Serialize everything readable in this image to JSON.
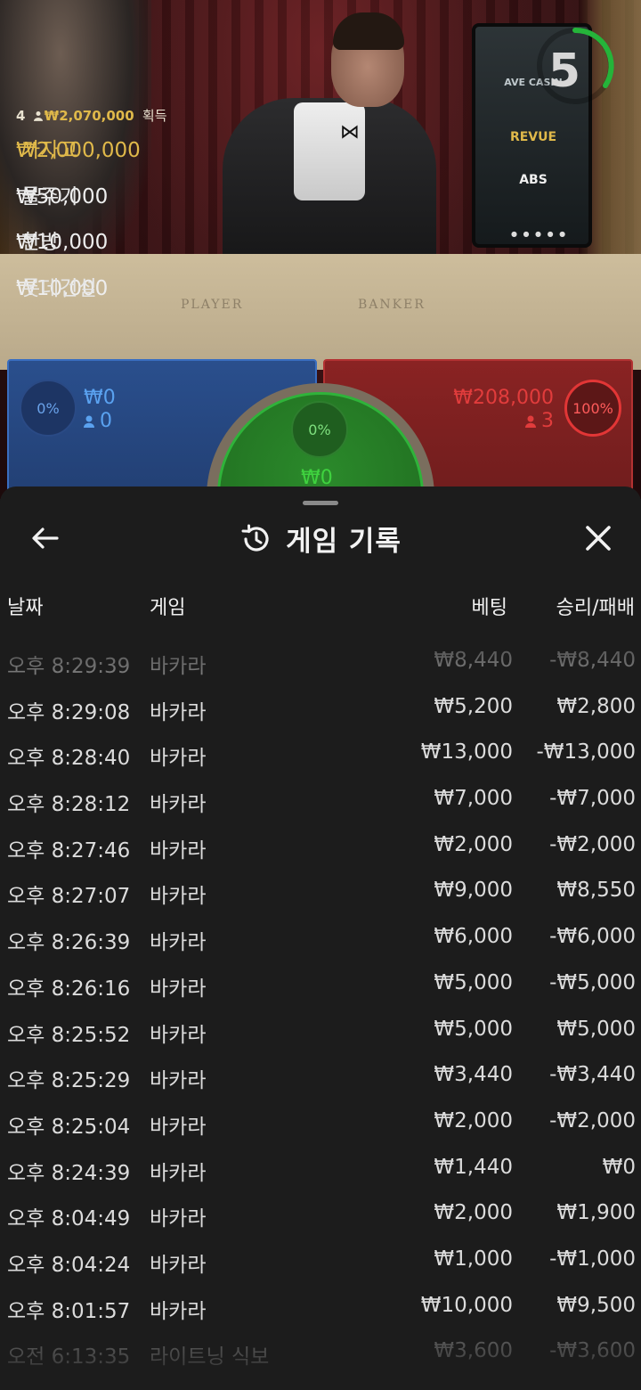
{
  "video": {
    "table_player_word": "PLAYER",
    "table_banker_word": "BANKER",
    "countdown": "5",
    "monitor_logos": [
      "AVE CASIN",
      "REVUE",
      "ABS"
    ]
  },
  "winners": {
    "count": "4",
    "total": "₩2,070,000",
    "total_suffix": "획득",
    "list": [
      {
        "amount": "₩2,000,000",
        "name": "가자고"
      },
      {
        "amount": "₩50,000",
        "name": "물주기"
      },
      {
        "amount": "₩10,000",
        "name": "한방"
      },
      {
        "amount": "₩10,000",
        "name": "롯데건설"
      }
    ]
  },
  "bets": {
    "player": {
      "percent": "0%",
      "amount": "₩0",
      "players": "0"
    },
    "banker": {
      "percent": "100%",
      "amount": "₩208,000",
      "players": "3"
    },
    "tie": {
      "percent": "0%",
      "amount": "₩0"
    }
  },
  "sheet": {
    "title": "게임 기록",
    "columns": {
      "date": "날짜",
      "game": "게임",
      "bet": "베팅",
      "result": "승리/패배"
    },
    "rows": [
      {
        "date": "오후 8:29:39",
        "game": "바카라",
        "bet": "₩8,440",
        "result": "-₩8,440"
      },
      {
        "date": "오후 8:29:08",
        "game": "바카라",
        "bet": "₩5,200",
        "result": "₩2,800"
      },
      {
        "date": "오후 8:28:40",
        "game": "바카라",
        "bet": "₩13,000",
        "result": "-₩13,000"
      },
      {
        "date": "오후 8:28:12",
        "game": "바카라",
        "bet": "₩7,000",
        "result": "-₩7,000"
      },
      {
        "date": "오후 8:27:46",
        "game": "바카라",
        "bet": "₩2,000",
        "result": "-₩2,000"
      },
      {
        "date": "오후 8:27:07",
        "game": "바카라",
        "bet": "₩9,000",
        "result": "₩8,550"
      },
      {
        "date": "오후 8:26:39",
        "game": "바카라",
        "bet": "₩6,000",
        "result": "-₩6,000"
      },
      {
        "date": "오후 8:26:16",
        "game": "바카라",
        "bet": "₩5,000",
        "result": "-₩5,000"
      },
      {
        "date": "오후 8:25:52",
        "game": "바카라",
        "bet": "₩5,000",
        "result": "₩5,000"
      },
      {
        "date": "오후 8:25:29",
        "game": "바카라",
        "bet": "₩3,440",
        "result": "-₩3,440"
      },
      {
        "date": "오후 8:25:04",
        "game": "바카라",
        "bet": "₩2,000",
        "result": "-₩2,000"
      },
      {
        "date": "오후 8:24:39",
        "game": "바카라",
        "bet": "₩1,440",
        "result": "₩0"
      },
      {
        "date": "오후 8:04:49",
        "game": "바카라",
        "bet": "₩2,000",
        "result": "₩1,900"
      },
      {
        "date": "오후 8:04:24",
        "game": "바카라",
        "bet": "₩1,000",
        "result": "-₩1,000"
      },
      {
        "date": "오후 8:01:57",
        "game": "바카라",
        "bet": "₩10,000",
        "result": "₩9,500"
      },
      {
        "date": "오전 6:13:35",
        "game": "라이트닝 식보",
        "bet": "₩3,600",
        "result": "-₩3,600"
      }
    ]
  }
}
